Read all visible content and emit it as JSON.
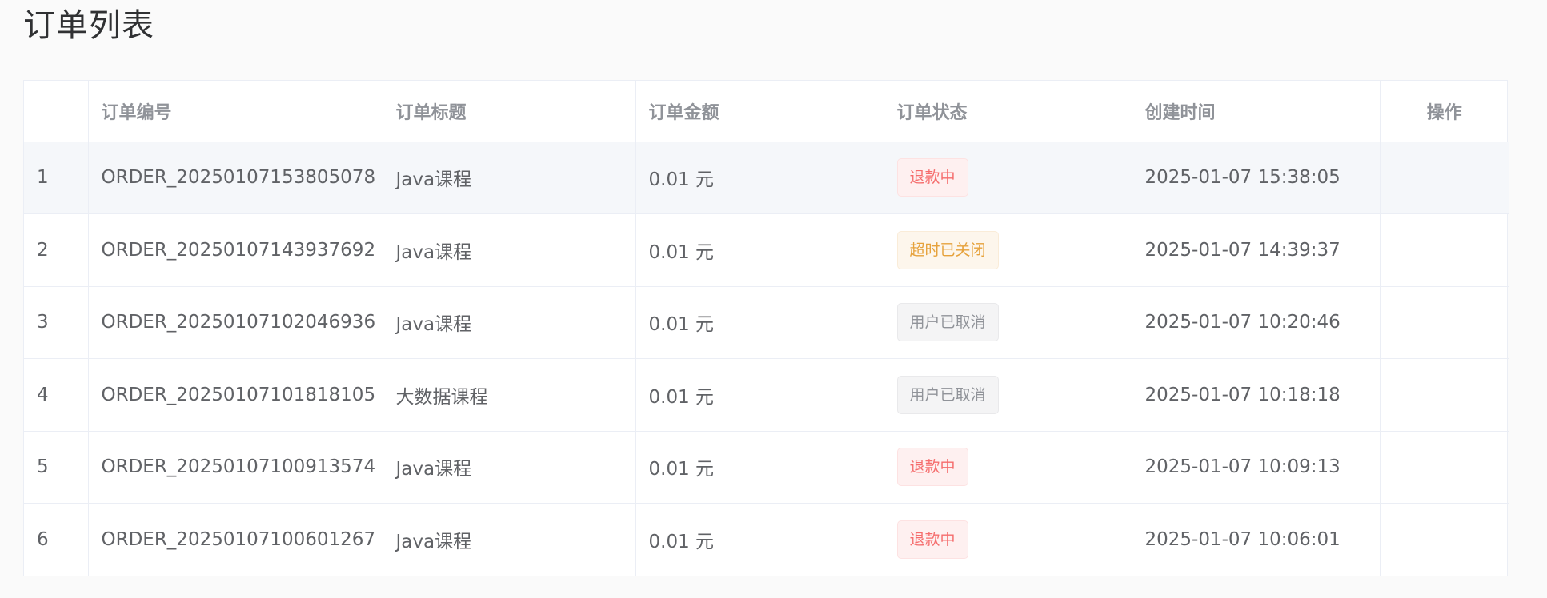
{
  "page": {
    "title": "订单列表"
  },
  "table": {
    "headers": {
      "index": "",
      "order_no": "订单编号",
      "title": "订单标题",
      "amount": "订单金额",
      "status": "订单状态",
      "created": "创建时间",
      "action": "操作"
    },
    "rows": [
      {
        "index": "1",
        "order_no": "ORDER_20250107153805078",
        "title": "Java课程",
        "amount": "0.01 元",
        "status": "退款中",
        "status_type": "danger",
        "created": "2025-01-07 15:38:05",
        "highlighted": true
      },
      {
        "index": "2",
        "order_no": "ORDER_20250107143937692",
        "title": "Java课程",
        "amount": "0.01 元",
        "status": "超时已关闭",
        "status_type": "warning",
        "created": "2025-01-07 14:39:37",
        "highlighted": false
      },
      {
        "index": "3",
        "order_no": "ORDER_20250107102046936",
        "title": "Java课程",
        "amount": "0.01 元",
        "status": "用户已取消",
        "status_type": "info",
        "created": "2025-01-07 10:20:46",
        "highlighted": false
      },
      {
        "index": "4",
        "order_no": "ORDER_20250107101818105",
        "title": "大数据课程",
        "amount": "0.01 元",
        "status": "用户已取消",
        "status_type": "info",
        "created": "2025-01-07 10:18:18",
        "highlighted": false
      },
      {
        "index": "5",
        "order_no": "ORDER_20250107100913574",
        "title": "Java课程",
        "amount": "0.01 元",
        "status": "退款中",
        "status_type": "danger",
        "created": "2025-01-07 10:09:13",
        "highlighted": false
      },
      {
        "index": "6",
        "order_no": "ORDER_20250107100601267",
        "title": "Java课程",
        "amount": "0.01 元",
        "status": "退款中",
        "status_type": "danger",
        "created": "2025-01-07 10:06:01",
        "highlighted": false
      }
    ]
  },
  "colors": {
    "danger": "#f56c6c",
    "warning": "#e6a23c",
    "info": "#909399",
    "row_hover": "#f5f7fa"
  }
}
